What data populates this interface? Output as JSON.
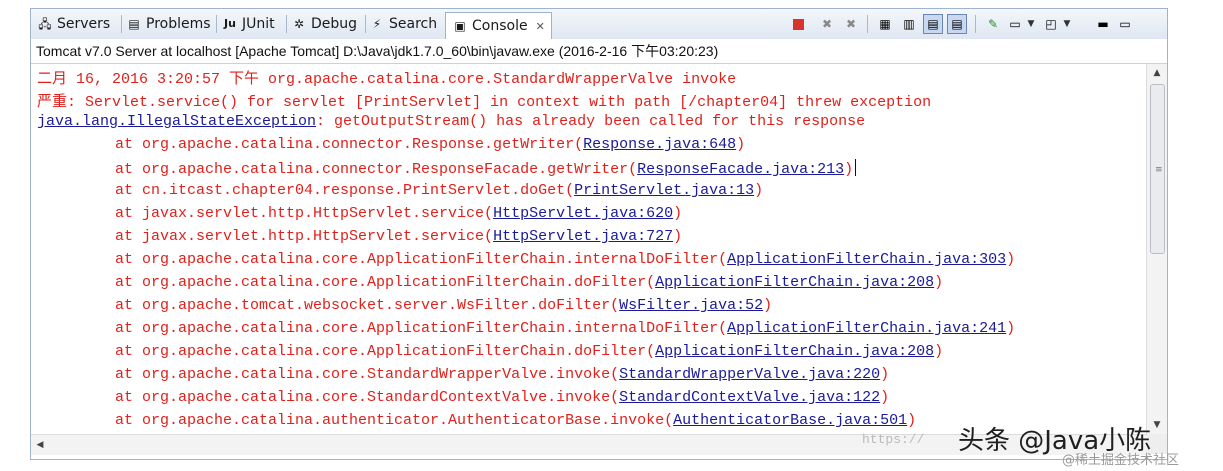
{
  "tabs": [
    {
      "label": "Servers",
      "icon": "servers-icon"
    },
    {
      "label": "Problems",
      "icon": "problems-icon"
    },
    {
      "label": "JUnit",
      "icon": "junit-icon"
    },
    {
      "label": "Debug",
      "icon": "debug-icon"
    },
    {
      "label": "Search",
      "icon": "search-icon"
    },
    {
      "label": "Console",
      "icon": "console-icon",
      "active": true
    }
  ],
  "status": {
    "launch": "Tomcat v7.0 Server at localhost [Apache Tomcat] D:\\Java\\jdk1.7.0_60\\bin\\javaw.exe (2016-2-16 下午03:20:23)"
  },
  "console": {
    "header1": "二月 16, 2016 3:20:57 下午 org.apache.catalina.core.StandardWrapperValve invoke",
    "header2": "严重: Servlet.service() for servlet [PrintServlet] in context with path [/chapter04] threw exception",
    "exception_class": "java.lang.IllegalStateException",
    "exception_msg": ": getOutputStream() has already been called for this response",
    "frames": [
      {
        "method": "at org.apache.catalina.connector.Response.getWriter(",
        "source": "Response.java:648"
      },
      {
        "method": "at org.apache.catalina.connector.ResponseFacade.getWriter(",
        "source": "ResponseFacade.java:213"
      },
      {
        "method": "at cn.itcast.chapter04.response.PrintServlet.doGet(",
        "source": "PrintServlet.java:13"
      },
      {
        "method": "at javax.servlet.http.HttpServlet.service(",
        "source": "HttpServlet.java:620"
      },
      {
        "method": "at javax.servlet.http.HttpServlet.service(",
        "source": "HttpServlet.java:727"
      },
      {
        "method": "at org.apache.catalina.core.ApplicationFilterChain.internalDoFilter(",
        "source": "ApplicationFilterChain.java:303"
      },
      {
        "method": "at org.apache.catalina.core.ApplicationFilterChain.doFilter(",
        "source": "ApplicationFilterChain.java:208"
      },
      {
        "method": "at org.apache.tomcat.websocket.server.WsFilter.doFilter(",
        "source": "WsFilter.java:52"
      },
      {
        "method": "at org.apache.catalina.core.ApplicationFilterChain.internalDoFilter(",
        "source": "ApplicationFilterChain.java:241"
      },
      {
        "method": "at org.apache.catalina.core.ApplicationFilterChain.doFilter(",
        "source": "ApplicationFilterChain.java:208"
      },
      {
        "method": "at org.apache.catalina.core.StandardWrapperValve.invoke(",
        "source": "StandardWrapperValve.java:220"
      },
      {
        "method": "at org.apache.catalina.core.StandardContextValve.invoke(",
        "source": "StandardContextValve.java:122"
      },
      {
        "method": "at org.apache.catalina.authenticator.AuthenticatorBase.invoke(",
        "source": "AuthenticatorBase.java:501"
      }
    ],
    "close_paren": ")"
  },
  "watermark": {
    "main": "头条 @Java小陈",
    "sub": "@稀土掘金技术社区",
    "url": "https://"
  },
  "colors": {
    "error_text": "#e0201b",
    "link": "#1a1a9a",
    "stop_button": "#d9342b"
  }
}
